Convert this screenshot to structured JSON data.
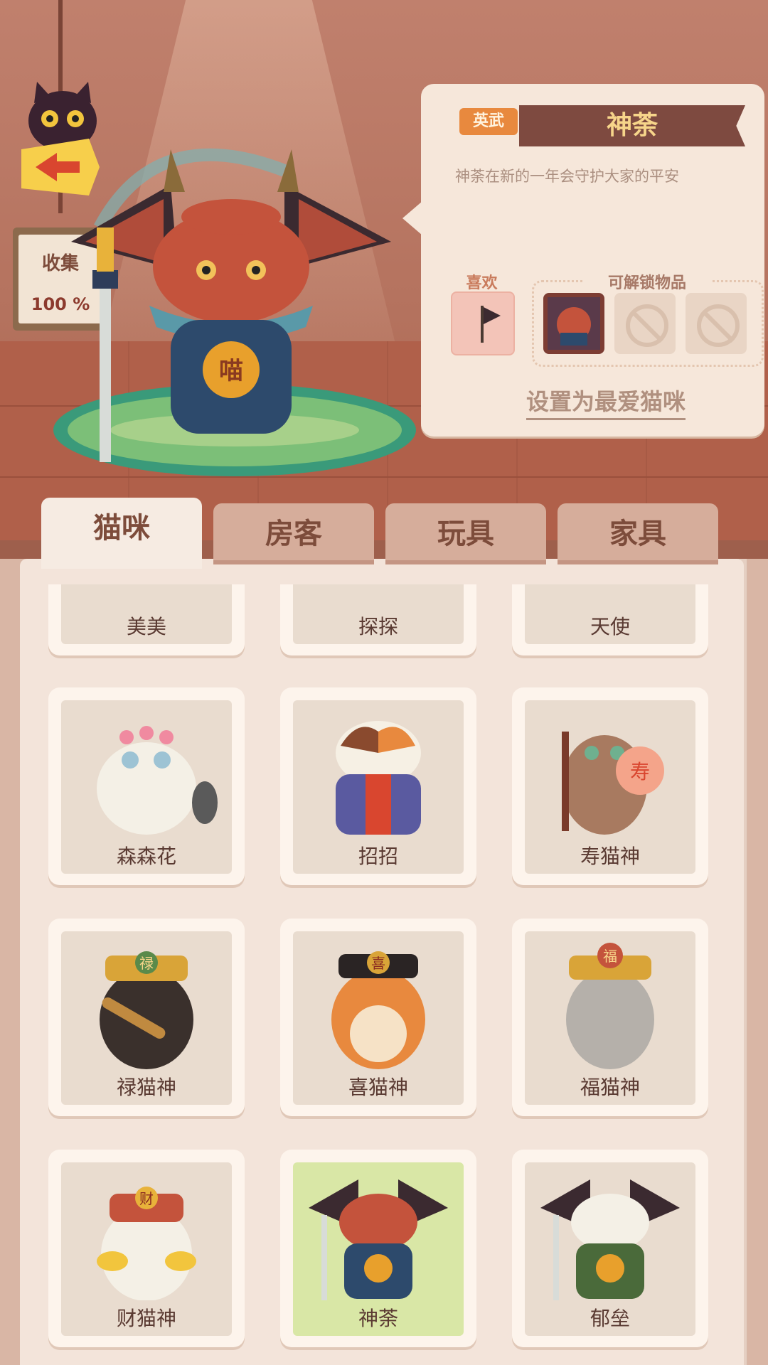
{
  "collection": {
    "label": "收集",
    "value": "100 %"
  },
  "detail": {
    "tag": "英武",
    "name": "神荼",
    "description": "神荼在新的一年会守护大家的平安",
    "like_label": "喜欢",
    "unlock_label": "可解锁物品",
    "set_favorite": "设置为最爱猫咪"
  },
  "tabs": [
    {
      "label": "猫咪",
      "active": true
    },
    {
      "label": "房客",
      "active": false
    },
    {
      "label": "玩具",
      "active": false
    },
    {
      "label": "家具",
      "active": false
    }
  ],
  "cats": [
    {
      "name": "美美"
    },
    {
      "name": "探探"
    },
    {
      "name": "天使"
    },
    {
      "name": "森森花"
    },
    {
      "name": "招招"
    },
    {
      "name": "寿猫神"
    },
    {
      "name": "禄猫神"
    },
    {
      "name": "喜猫神"
    },
    {
      "name": "福猫神"
    },
    {
      "name": "财猫神"
    },
    {
      "name": "神荼",
      "selected": true
    },
    {
      "name": "郁垒"
    }
  ],
  "colors": {
    "accent": "#e8893e",
    "banner": "#7e4a40",
    "selected_bg": "#d9e7a6"
  }
}
